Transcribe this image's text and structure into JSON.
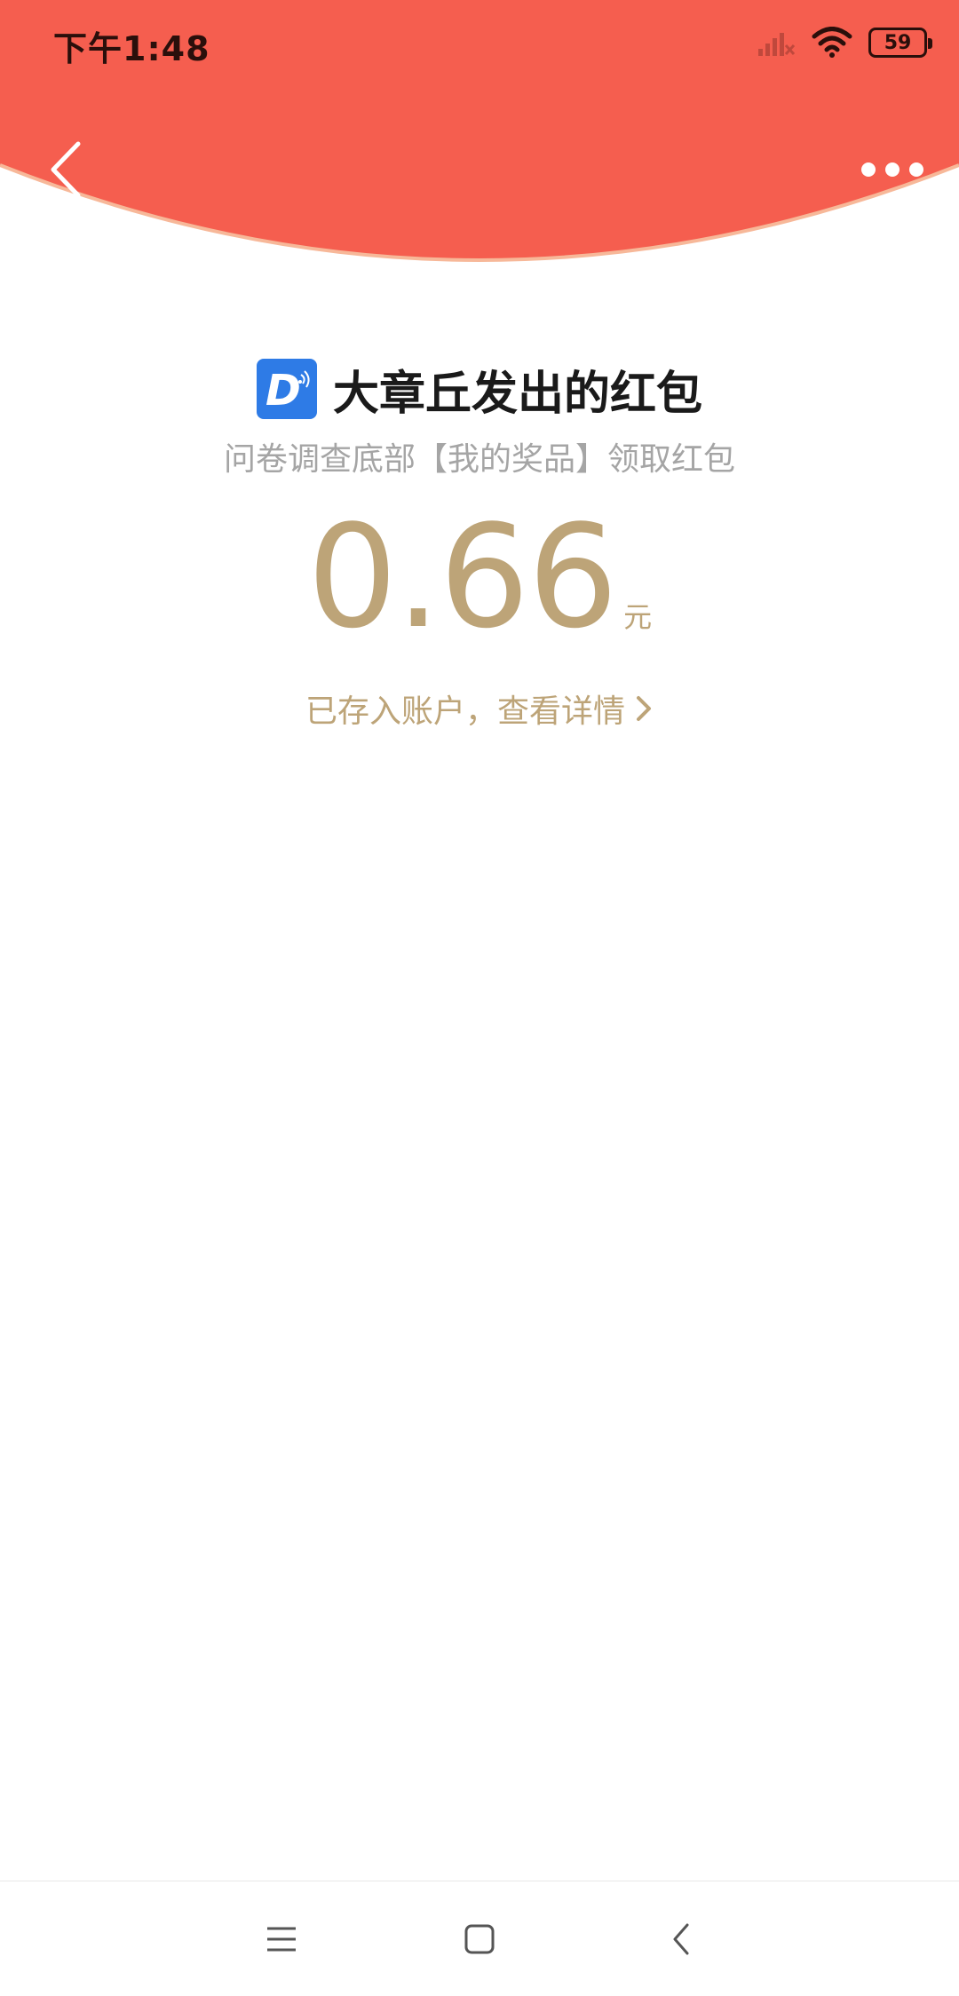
{
  "status_bar": {
    "time": "下午1:48",
    "battery": "59",
    "icons": [
      "signal-icon",
      "wifi-icon",
      "battery-icon"
    ]
  },
  "header": {
    "color": "#f55e4f",
    "back_icon": "chevron-left-icon",
    "more_icon": "more-dots-icon"
  },
  "sender": {
    "logo_letter": "D",
    "title": "大章丘发出的红包",
    "logo_color": "#2e7be6"
  },
  "message": "问卷调查底部【我的奖品】领取红包",
  "amount": {
    "value": "0.66",
    "unit": "元",
    "color": "#bda478"
  },
  "details_link": {
    "label": "已存入账户，查看详情"
  },
  "system_nav": {
    "icons": [
      "menu-icon",
      "home-icon",
      "back-icon"
    ]
  }
}
